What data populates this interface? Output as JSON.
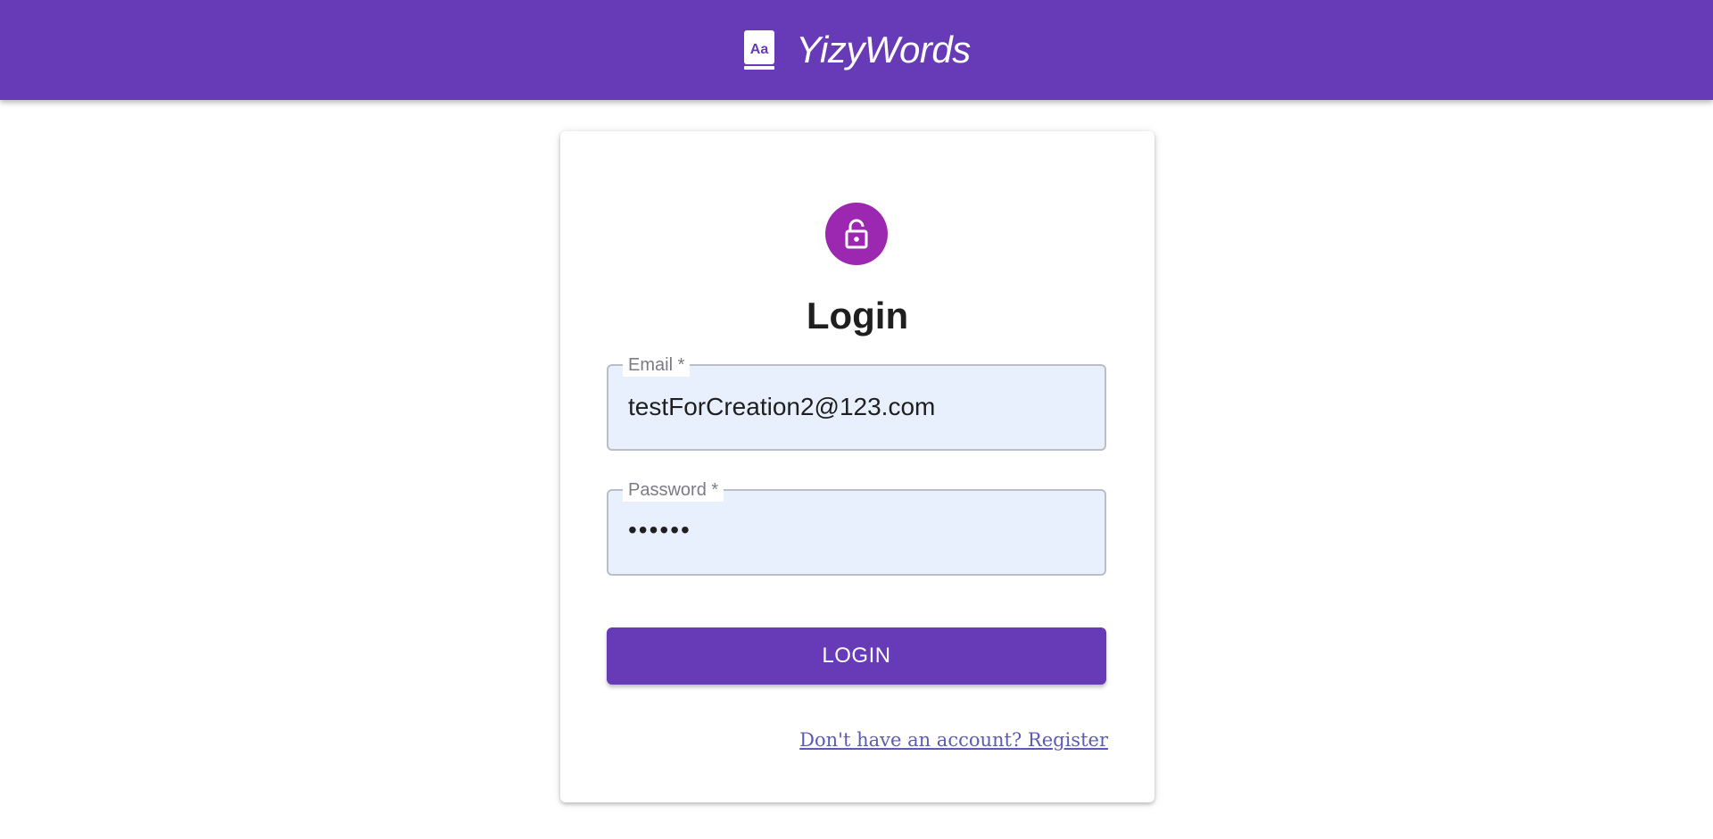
{
  "header": {
    "title": "YizyWords",
    "icon": "dictionary-book-icon",
    "background_color": "#673ab7"
  },
  "login_card": {
    "avatar_icon": "unlock-icon",
    "avatar_color": "#9c27b0",
    "title": "Login",
    "email": {
      "label": "Email *",
      "value": "testForCreation2@123.com"
    },
    "password": {
      "label": "Password *",
      "value": "••••••"
    },
    "submit_label": "LOGIN",
    "register_link": "Don't have an account? Register"
  }
}
